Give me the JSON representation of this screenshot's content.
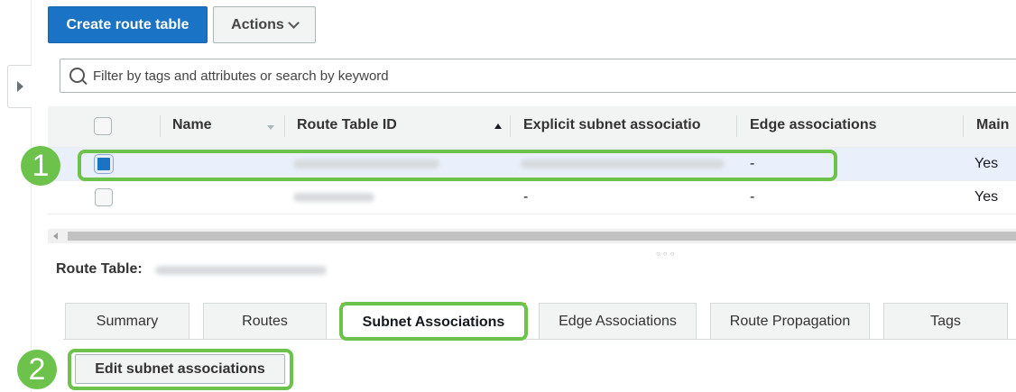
{
  "toolbar": {
    "create_label": "Create route table",
    "actions_label": "Actions"
  },
  "search": {
    "placeholder": "Filter by tags and attributes or search by keyword"
  },
  "table": {
    "columns": {
      "name": "Name",
      "route_table_id": "Route Table ID",
      "explicit": "Explicit subnet associatio",
      "edge": "Edge associations",
      "main": "Main"
    },
    "rows": [
      {
        "selected": true,
        "edge": "-",
        "main": "Yes"
      },
      {
        "selected": false,
        "explicit": "-",
        "edge": "-",
        "main": "Yes"
      }
    ]
  },
  "details": {
    "route_table_label": "Route Table:",
    "tabs": [
      "Summary",
      "Routes",
      "Subnet Associations",
      "Edge Associations",
      "Route Propagation",
      "Tags"
    ],
    "active_tab": "Subnet Associations",
    "edit_label": "Edit subnet associations"
  },
  "annotations": {
    "step1": "1",
    "step2": "2"
  },
  "colors": {
    "primary": "#1a73c5",
    "highlight": "#6cc24a",
    "active_tab": "#ec7211"
  },
  "icons": [
    "search-icon",
    "chevron-down-icon",
    "expand-panel-icon",
    "sort-asc-icon",
    "sort-icon"
  ]
}
